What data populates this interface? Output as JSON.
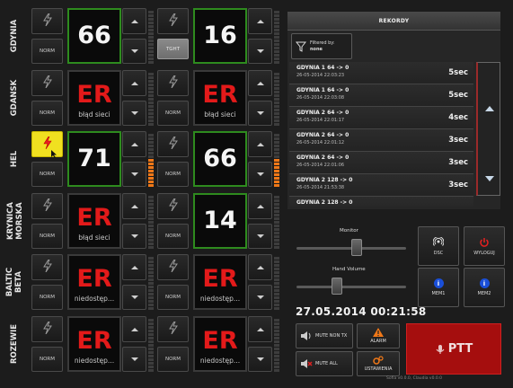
{
  "stations": [
    {
      "name": "GDYNIA",
      "left": {
        "value": "66",
        "status": "ok",
        "sub": "",
        "mode": "NORM",
        "active": false,
        "level": 0
      },
      "right": {
        "value": "16",
        "status": "ok",
        "sub": "",
        "mode": "TGHT",
        "level": 0
      }
    },
    {
      "name": "GDANSK",
      "left": {
        "value": "ER",
        "status": "err",
        "sub": "błąd sieci",
        "mode": "NORM",
        "active": false,
        "level": 0
      },
      "right": {
        "value": "ER",
        "status": "err",
        "sub": "błąd sieci",
        "mode": "NORM",
        "level": 0
      }
    },
    {
      "name": "HEL",
      "left": {
        "value": "71",
        "status": "ok",
        "sub": "",
        "mode": "NORM",
        "active": true,
        "level": 8
      },
      "right": {
        "value": "66",
        "status": "ok",
        "sub": "",
        "mode": "NORM",
        "level": 8
      }
    },
    {
      "name": "KRYNICA\nMORSKA",
      "left": {
        "value": "ER",
        "status": "err",
        "sub": "błąd sieci",
        "mode": "NORM",
        "active": false,
        "level": 0
      },
      "right": {
        "value": "14",
        "status": "ok",
        "sub": "",
        "mode": "NORM",
        "level": 0
      }
    },
    {
      "name": "BALTIC\nBETA",
      "left": {
        "value": "ER",
        "status": "err",
        "sub": "niedostęp...",
        "mode": "NORM",
        "active": false,
        "level": 0
      },
      "right": {
        "value": "ER",
        "status": "err",
        "sub": "niedostęp...",
        "mode": "NORM",
        "level": 0
      }
    },
    {
      "name": "ROZEWIE",
      "left": {
        "value": "ER",
        "status": "err",
        "sub": "niedostęp...",
        "mode": "NORM",
        "active": false,
        "level": 0
      },
      "right": {
        "value": "ER",
        "status": "err",
        "sub": "niedostęp...",
        "mode": "NORM",
        "level": 0
      }
    }
  ],
  "records": {
    "title": "REKORDY",
    "filter_label": "Filtered by:",
    "filter_value": "none",
    "items": [
      {
        "title": "GDYNIA 1 64 -> 0",
        "date": "26-05-2014 22:03:23",
        "duration": "5sec"
      },
      {
        "title": "GDYNIA 1 64 -> 0",
        "date": "26-05-2014 22:03:08",
        "duration": "5sec"
      },
      {
        "title": "GDYNIA 2 64 -> 0",
        "date": "26-05-2014 22:01:17",
        "duration": "4sec"
      },
      {
        "title": "GDYNIA 2 64 -> 0",
        "date": "26-05-2014 22:01:12",
        "duration": "3sec"
      },
      {
        "title": "GDYNIA 2 64 -> 0",
        "date": "26-05-2014 22:01:06",
        "duration": "3sec"
      },
      {
        "title": "GDYNIA 2 128 -> 0",
        "date": "26-05-2014 21:53:38",
        "duration": "3sec"
      },
      {
        "title": "GDYNIA 2 128 -> 0",
        "date": "",
        "duration": ""
      }
    ]
  },
  "monitor": {
    "label": "Monitor",
    "value": 0.55
  },
  "hand_volume": {
    "label": "Hand Volume",
    "value": 0.35
  },
  "datetime": "27.05.2014 00:21:58",
  "buttons": {
    "dsc": "DSC",
    "logout": "WYLOGUJ",
    "mem1": "MEM1",
    "mem2": "MEM2",
    "mute_non_tx": "MUTE NON TX",
    "alarm": "ALARM",
    "mute_all": "MUTE ALL",
    "settings": "USTAWIENIA",
    "ptt": "PTT"
  },
  "footer": "Sofia v0.0.0, Claudia v0.0.0",
  "colors": {
    "ok_border": "#2e8b1e",
    "error_text": "#e31a1a",
    "level_on": "#f07818",
    "ptt": "#a50e0e",
    "active_bolt": "#f0e020"
  }
}
